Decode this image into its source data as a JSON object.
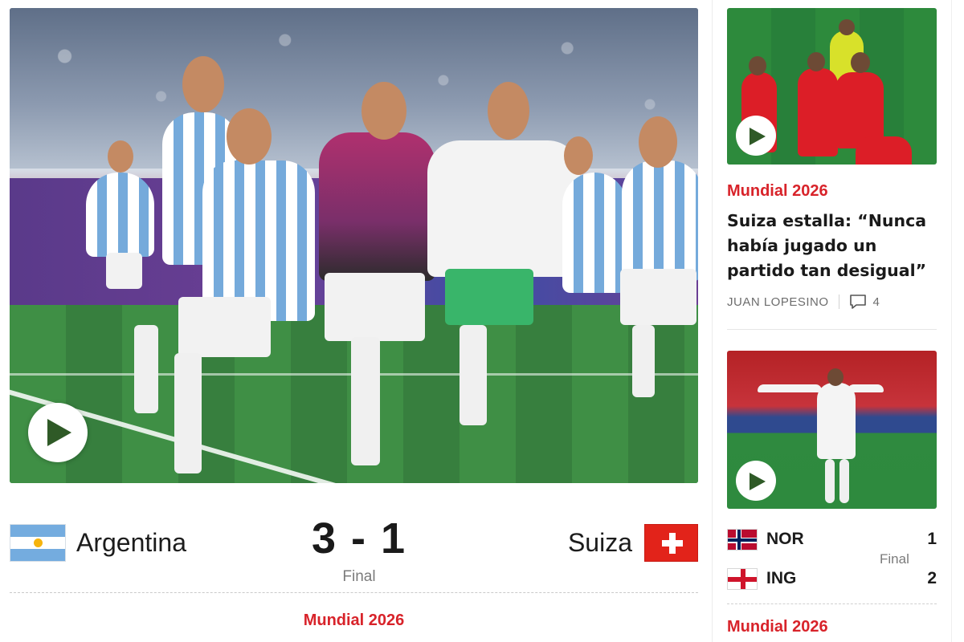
{
  "main_story": {
    "home_team": "Argentina",
    "away_team": "Suiza",
    "score": "3 - 1",
    "status": "Final",
    "category": "Mundial 2026",
    "media": "video"
  },
  "sidebar": {
    "story1": {
      "category": "Mundial 2026",
      "headline": "Suiza estalla: “Nunca había jugado un partido tan desigual”",
      "author": "JUAN LOPESINO",
      "comments": "4",
      "media": "video"
    },
    "story2": {
      "media": "video",
      "home_team": "NOR",
      "home_goals": "1",
      "away_team": "ING",
      "away_goals": "2",
      "status": "Final",
      "category": "Mundial 2026"
    }
  },
  "colors": {
    "accent": "#d8232a",
    "text": "#1c1c1c",
    "muted": "#7b7b7b"
  },
  "icons": [
    "play-icon",
    "comments-icon",
    "argentina-flag-icon",
    "switzerland-flag-icon",
    "norway-flag-icon",
    "england-flag-icon"
  ]
}
